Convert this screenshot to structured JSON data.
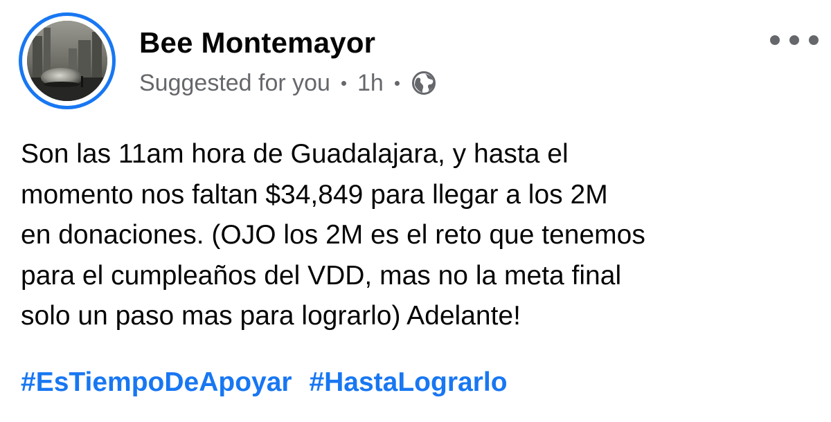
{
  "post": {
    "author": "Bee Montemayor",
    "meta": {
      "context": "Suggested for you",
      "time": "1h",
      "audience_icon": "globe-icon"
    },
    "more_icon": "more-options-icon",
    "text_lines": [
      "Son las 11am hora de Guadalajara,  y hasta el",
      "momento nos faltan $34,849 para llegar a los 2M",
      "en donaciones. (OJO los 2M es el reto que tenemos",
      "para el cumpleaños del VDD, mas no la meta final",
      "solo un paso mas para lograrlo) Adelante!"
    ],
    "hashtags": [
      "#EsTiempoDeApoyar",
      "#HastaLograrlo"
    ]
  },
  "colors": {
    "accent": "#1877f2",
    "text_primary": "#050505",
    "text_secondary": "#65676b"
  }
}
